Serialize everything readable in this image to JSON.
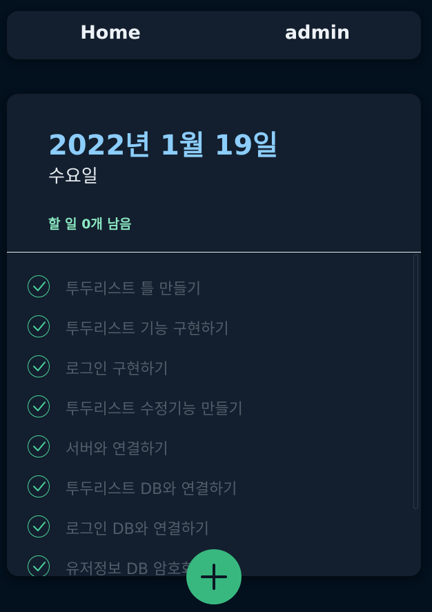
{
  "nav": {
    "home_label": "Home",
    "user_label": "admin"
  },
  "header": {
    "date": "2022년 1월 19일",
    "weekday": "수요일",
    "remaining": "할 일 0개 남음"
  },
  "todos": [
    {
      "text": "투두리스트 틀 만들기",
      "done": true
    },
    {
      "text": "투두리스트 기능 구현하기",
      "done": true
    },
    {
      "text": "로그인 구현하기",
      "done": true
    },
    {
      "text": "투두리스트 수정기능 만들기",
      "done": true
    },
    {
      "text": "서버와 연결하기",
      "done": true
    },
    {
      "text": "투두리스트 DB와 연결하기",
      "done": true
    },
    {
      "text": "로그인 DB와 연결하기",
      "done": true
    },
    {
      "text": "유저정보 DB 암호화",
      "done": true
    }
  ],
  "icons": {
    "check": "check-icon",
    "add": "plus-icon"
  },
  "colors": {
    "accent_green": "#38b87f",
    "date_blue": "#8ccdfb",
    "remaining_green": "#8be7c1",
    "background": "#03101d",
    "card": "#131f2e"
  }
}
